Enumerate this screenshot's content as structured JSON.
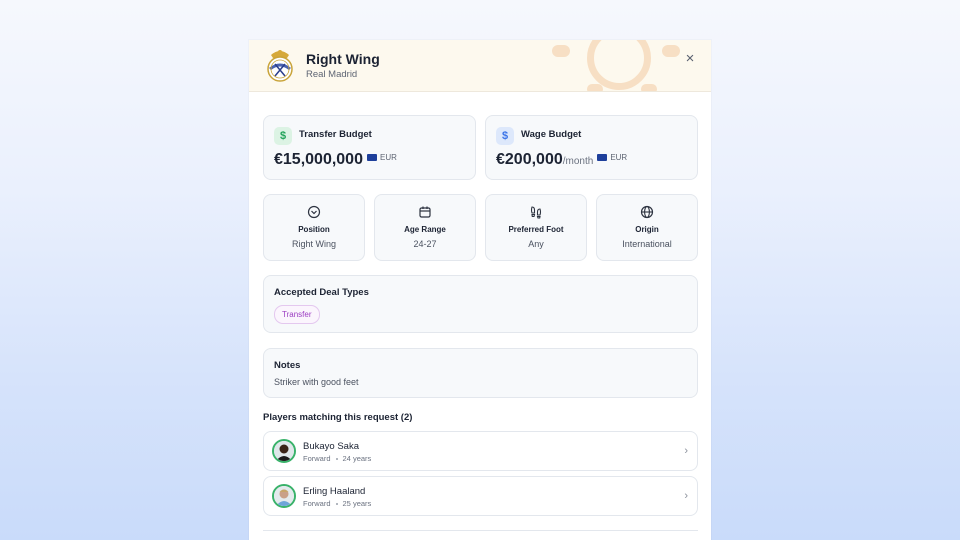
{
  "header": {
    "title": "Right Wing",
    "club": "Real Madrid",
    "close_label": "×"
  },
  "budgets": {
    "transfer": {
      "label": "Transfer Budget",
      "amount": "€15,000,000",
      "period": "",
      "currency": "EUR",
      "icon": "dollar-icon",
      "color": "#22a35a"
    },
    "wage": {
      "label": "Wage Budget",
      "amount": "€200,000",
      "period": "/month",
      "currency": "EUR",
      "icon": "dollar-icon",
      "color": "#3b74e8"
    }
  },
  "stats": [
    {
      "label": "Position",
      "value": "Right Wing",
      "icon": "position-chevron-icon"
    },
    {
      "label": "Age Range",
      "value": "24-27",
      "icon": "calendar-icon"
    },
    {
      "label": "Preferred Foot",
      "value": "Any",
      "icon": "footprints-icon"
    },
    {
      "label": "Origin",
      "value": "International",
      "icon": "globe-icon"
    }
  ],
  "deal_types": {
    "title": "Accepted Deal Types",
    "items": [
      "Transfer"
    ]
  },
  "notes": {
    "title": "Notes",
    "text": "Striker with good feet"
  },
  "matches": {
    "title": "Players matching this request (2)",
    "players": [
      {
        "name": "Bukayo Saka",
        "position": "Forward",
        "age": "24 years"
      },
      {
        "name": "Erling Haaland",
        "position": "Forward",
        "age": "25 years"
      }
    ]
  },
  "colors": {
    "accent_green": "#39b26a",
    "chip_purple": "#9b3cc2",
    "header_bg": "#fdf9ee"
  }
}
